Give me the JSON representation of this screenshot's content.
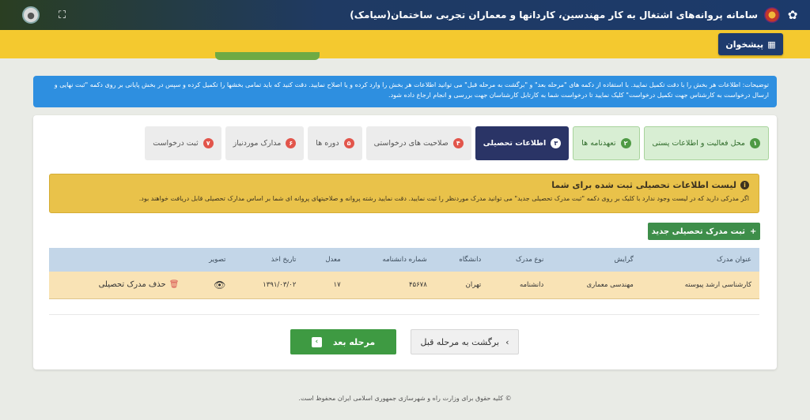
{
  "header": {
    "title": "سامانه پروانه‌های اشتغال به کار مهندسین، کاردانها و معماران تجربی ساختمان(سیامک)",
    "emblem_icon": "iran-emblem-icon",
    "logo_icon": "siamak-logo-icon",
    "fullscreen_icon": "expand-icon",
    "avatar_icon": "user-avatar-icon"
  },
  "dashboard_button": {
    "label": "پیشخوان",
    "icon": "grid-icon"
  },
  "notice": {
    "text": "توضیحات: اطلاعات هر بخش را با دقت تکمیل نمایید. با استفاده از دکمه های \"مرحله بعد\" و \"برگشت به مرحله قبل\" می توانید اطلاعات هر بخش را وارد کرده و یا اصلاح نمایید. دقت کنید که باید تمامی بخشها را تکمیل کرده و سپس در بخش پایانی بر روی دکمه \"ثبت نهایی و ارسال درخواست به کارشناس جهت تکمیل درخواست\" کلیک نمایید تا درخواست شما به کارتابل کارشناسان جهت بررسی و انجام ارجاع داده شود."
  },
  "steps": [
    {
      "num": "۱",
      "label": "محل فعالیت و اطلاعات پستی",
      "state": "done"
    },
    {
      "num": "۲",
      "label": "تعهدنامه ها",
      "state": "done"
    },
    {
      "num": "۳",
      "label": "اطلاعات تحصیلی",
      "state": "active"
    },
    {
      "num": "۴",
      "label": "صلاحیت های درخواستی",
      "state": "todo"
    },
    {
      "num": "۵",
      "label": "دوره ها",
      "state": "todo"
    },
    {
      "num": "۶",
      "label": "مدارک موردنیاز",
      "state": "todo"
    },
    {
      "num": "۷",
      "label": "ثبت درخواست",
      "state": "todo"
    }
  ],
  "alert": {
    "title": "لیست اطلاعات تحصیلی ثبت شده برای شما",
    "text": "اگر مدرکی دارید که در لیست وجود ندارد با کلیک بر روی دکمه \"ثبت مدرک تحصیلی جدید\" می توانید مدرک موردنظر را ثبت نمایید. دقت نمایید رشته پروانه و صلاحیتهای پروانه ای شما بر اساس مدارک تحصیلی قابل دریافت خواهند بود."
  },
  "add_button": {
    "label": "ثبت مدرک تحصیلی جدید",
    "icon": "plus"
  },
  "table": {
    "headers": [
      "عنوان مدرک",
      "گرایش",
      "نوع مدرک",
      "دانشگاه",
      "شماره دانشنامه",
      "معدل",
      "تاریخ اخذ",
      "تصویر",
      ""
    ],
    "rows": [
      {
        "title": "کارشناسی ارشد پیوسته",
        "field": "مهندسی معماری",
        "type": "دانشنامه",
        "university": "تهران",
        "number": "۴۵۶۷۸",
        "gpa": "۱۷",
        "date": "۱۳۹۱/۰۳/۰۲",
        "image_icon": "eye-icon",
        "delete_label": "حذف مدرک تحصیلی"
      }
    ]
  },
  "buttons": {
    "next": "مرحله بعد",
    "prev": "برگشت به مرحله قبل"
  },
  "footer": {
    "text": "© کلیه حقوق برای وزارت راه و شهرسازی جمهوری اسلامی ایران محفوظ است."
  }
}
